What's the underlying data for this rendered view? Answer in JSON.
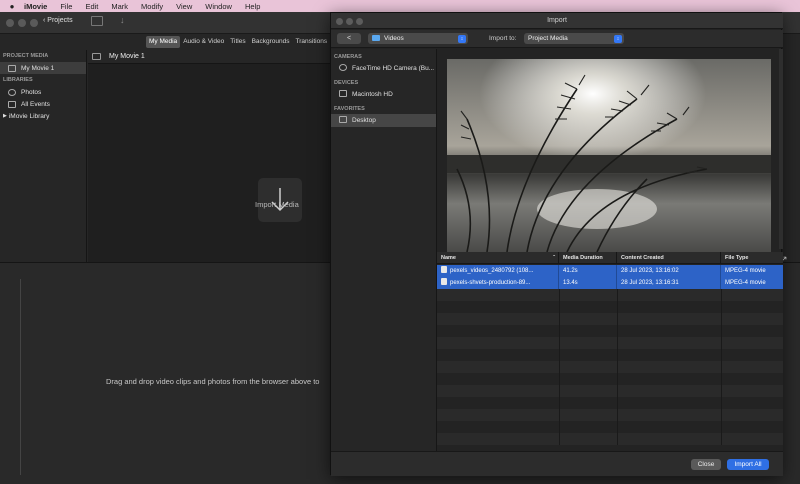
{
  "menubar": {
    "apple_icon": "apple-icon",
    "items": [
      "iMovie",
      "File",
      "Edit",
      "Mark",
      "Modify",
      "View",
      "Window",
      "Help"
    ]
  },
  "imovie": {
    "projects_label": "Projects",
    "browser_tabs": [
      "My Media",
      "Audio & Video",
      "Titles",
      "Backgrounds",
      "Transitions"
    ],
    "sidebar": {
      "project_media_heading": "PROJECT MEDIA",
      "project_item": "My Movie 1",
      "libraries_heading": "LIBRARIES",
      "library_items": [
        "Photos",
        "All Events",
        "iMovie Library"
      ]
    },
    "browser_title": "My Movie 1",
    "import_media_label": "Import Media",
    "timeline_hint": "Drag and drop video clips and photos from the browser above to"
  },
  "dialog": {
    "title": "Import",
    "back_label": "<",
    "location": "Videos",
    "import_to_label": "Import to:",
    "import_to_value": "Project Media",
    "sidebar": {
      "cameras_heading": "CAMERAS",
      "camera_item": "FaceTime HD Camera (Bu...",
      "devices_heading": "DEVICES",
      "device_item": "Macintosh HD",
      "favorites_heading": "FAVORITES",
      "favorite_item": "Desktop"
    },
    "table": {
      "columns": [
        "Name",
        "Media Duration",
        "Content Created",
        "File Type"
      ],
      "rows": [
        {
          "name": "pexels_videos_2480792 (108...",
          "duration": "41.2s",
          "created": "28 Jul 2023, 13:16:02",
          "type": "MPEG-4 movie"
        },
        {
          "name": "pexels-shvets-production-89...",
          "duration": "13.4s",
          "created": "28 Jul 2023, 13:16:31",
          "type": "MPEG-4 movie"
        }
      ]
    },
    "close_label": "Close",
    "import_all_label": "Import All"
  }
}
